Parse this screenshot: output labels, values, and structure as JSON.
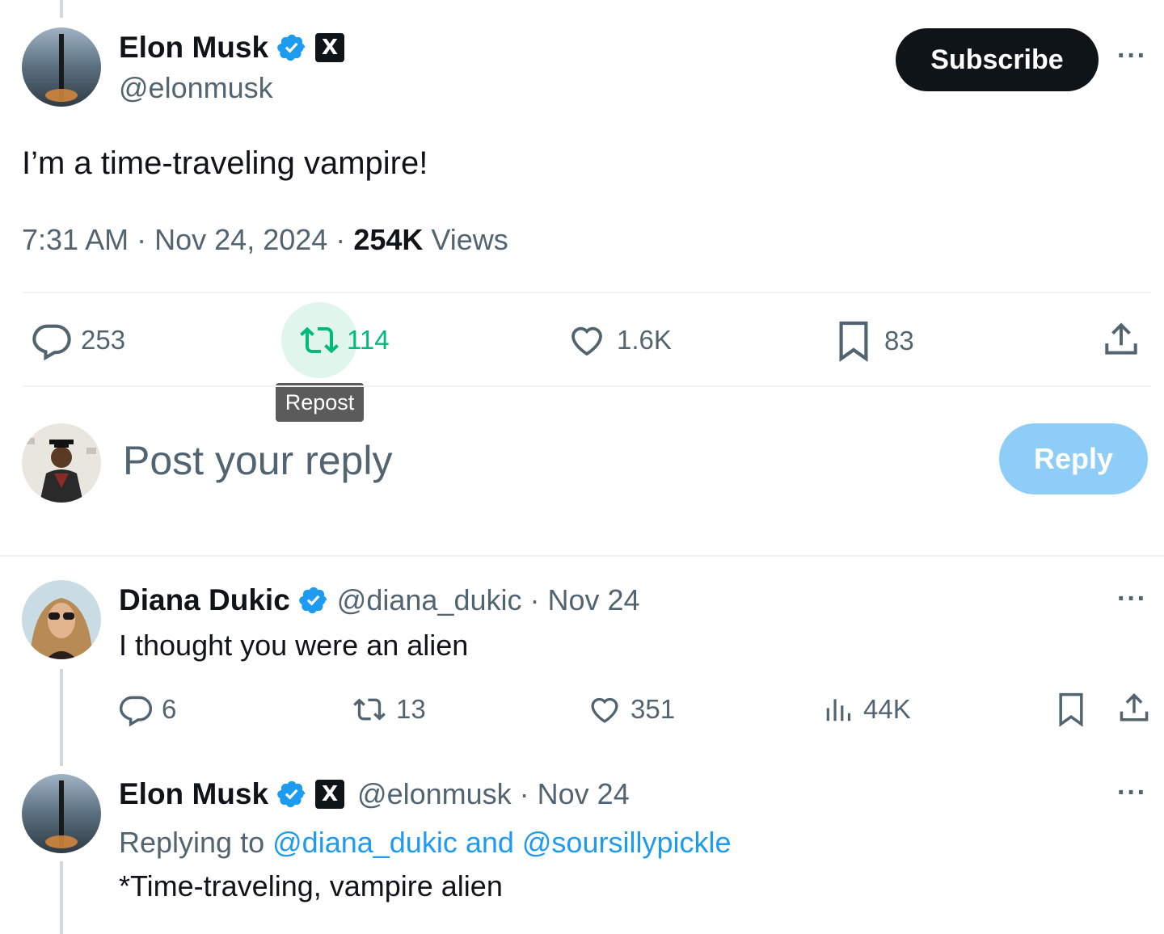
{
  "main_tweet": {
    "author": {
      "name": "Elon Musk",
      "handle": "@elonmusk",
      "affiliate_badge": "X"
    },
    "subscribe_label": "Subscribe",
    "more_label": "···",
    "text": "I’m a time-traveling vampire!",
    "time": "7:31 AM",
    "date": "Nov 24, 2024",
    "views_count": "254K",
    "views_label": "Views",
    "separator": "·",
    "actions": {
      "replies": "253",
      "reposts": "114",
      "likes": "1.6K",
      "bookmarks": "83"
    },
    "tooltip": "Repost"
  },
  "composer": {
    "placeholder": "Post your reply",
    "reply_button": "Reply"
  },
  "replies": [
    {
      "name": "Diana Dukic",
      "handle": "@diana_dukic",
      "date": "Nov 24",
      "text": "I thought you were an alien",
      "actions": {
        "replies": "6",
        "reposts": "13",
        "likes": "351",
        "views": "44K"
      }
    },
    {
      "name": "Elon Musk",
      "affiliate_badge": "X",
      "handle": "@elonmusk",
      "date": "Nov 24",
      "replying_prefix": "Replying to",
      "replying_to": "@diana_dukic and @soursillypickle",
      "text": "*Time-traveling, vampire alien"
    }
  ],
  "colors": {
    "accent": "#1d9bf0",
    "repost_green": "#00ba7c",
    "muted": "#536471",
    "text": "#0f1419",
    "reply_button_disabled": "#8ecdf8"
  }
}
